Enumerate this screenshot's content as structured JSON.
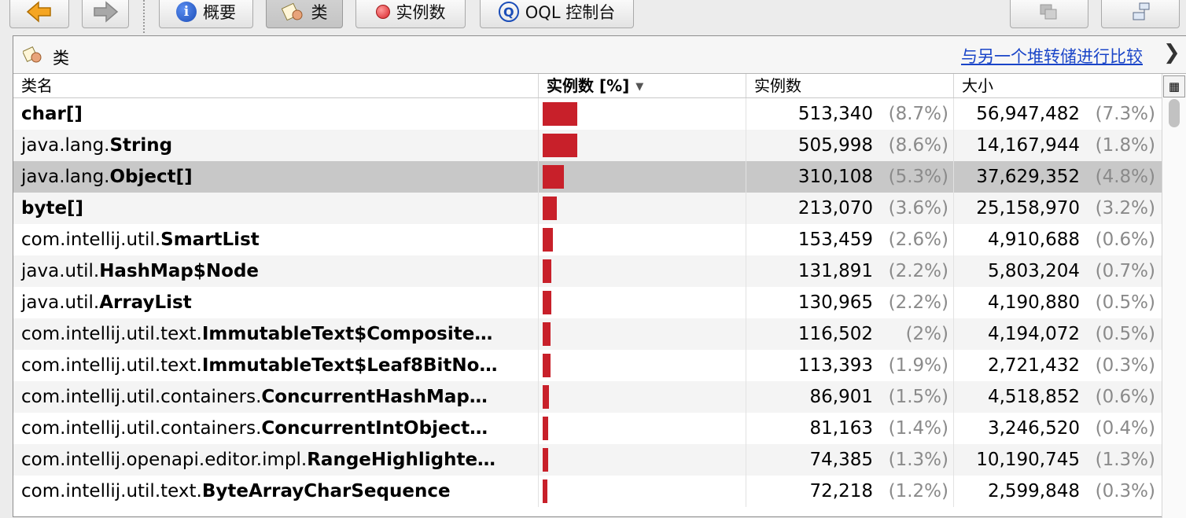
{
  "toolbar": {
    "back_label": "",
    "forward_label": "",
    "summary_label": "概要",
    "classes_label": "类",
    "instances_label": "实例数",
    "oql_label": "OQL 控制台"
  },
  "panel": {
    "title": "类",
    "compare_link": "与另一个堆转储进行比较",
    "close_glyph": "❯"
  },
  "table": {
    "columns": [
      "类名",
      "实例数 [%]",
      "实例数",
      "大小"
    ],
    "sort_arrow": "▼",
    "rows": [
      {
        "pkg": "",
        "cls": "char[]",
        "bar": 0.087,
        "count": "513,340",
        "count_pct": "(8.7%)",
        "size": "56,947,482",
        "size_pct": "(7.3%)"
      },
      {
        "pkg": "java.lang.",
        "cls": "String",
        "bar": 0.086,
        "count": "505,998",
        "count_pct": "(8.6%)",
        "size": "14,167,944",
        "size_pct": "(1.8%)"
      },
      {
        "pkg": "java.lang.",
        "cls": "Object[]",
        "bar": 0.053,
        "count": "310,108",
        "count_pct": "(5.3%)",
        "size": "37,629,352",
        "size_pct": "(4.8%)"
      },
      {
        "pkg": "",
        "cls": "byte[]",
        "bar": 0.036,
        "count": "213,070",
        "count_pct": "(3.6%)",
        "size": "25,158,970",
        "size_pct": "(3.2%)"
      },
      {
        "pkg": "com.intellij.util.",
        "cls": "SmartList",
        "bar": 0.026,
        "count": "153,459",
        "count_pct": "(2.6%)",
        "size": "4,910,688",
        "size_pct": "(0.6%)"
      },
      {
        "pkg": "java.util.",
        "cls": "HashMap$Node",
        "bar": 0.022,
        "count": "131,891",
        "count_pct": "(2.2%)",
        "size": "5,803,204",
        "size_pct": "(0.7%)"
      },
      {
        "pkg": "java.util.",
        "cls": "ArrayList",
        "bar": 0.022,
        "count": "130,965",
        "count_pct": "(2.2%)",
        "size": "4,190,880",
        "size_pct": "(0.5%)"
      },
      {
        "pkg": "com.intellij.util.text.",
        "cls": "ImmutableText$Composite…",
        "bar": 0.02,
        "count": "116,502",
        "count_pct": "(2%)",
        "size": "4,194,072",
        "size_pct": "(0.5%)"
      },
      {
        "pkg": "com.intellij.util.text.",
        "cls": "ImmutableText$Leaf8BitNo…",
        "bar": 0.019,
        "count": "113,393",
        "count_pct": "(1.9%)",
        "size": "2,721,432",
        "size_pct": "(0.3%)"
      },
      {
        "pkg": "com.intellij.util.containers.",
        "cls": "ConcurrentHashMap…",
        "bar": 0.015,
        "count": "86,901",
        "count_pct": "(1.5%)",
        "size": "4,518,852",
        "size_pct": "(0.6%)"
      },
      {
        "pkg": "com.intellij.util.containers.",
        "cls": "ConcurrentIntObject…",
        "bar": 0.014,
        "count": "81,163",
        "count_pct": "(1.4%)",
        "size": "3,246,520",
        "size_pct": "(0.4%)"
      },
      {
        "pkg": "com.intellij.openapi.editor.impl.",
        "cls": "RangeHighlighte…",
        "bar": 0.013,
        "count": "74,385",
        "count_pct": "(1.3%)",
        "size": "10,190,745",
        "size_pct": "(1.3%)"
      },
      {
        "pkg": "com.intellij.util.text.",
        "cls": "ByteArrayCharSequence",
        "bar": 0.012,
        "count": "72,218",
        "count_pct": "(1.2%)",
        "size": "2,599,848",
        "size_pct": "(0.3%)"
      }
    ],
    "selected_row": 2
  },
  "colors": {
    "bar": "#c8202a",
    "link": "#1a45c8",
    "selection": "#c8c8c8"
  }
}
